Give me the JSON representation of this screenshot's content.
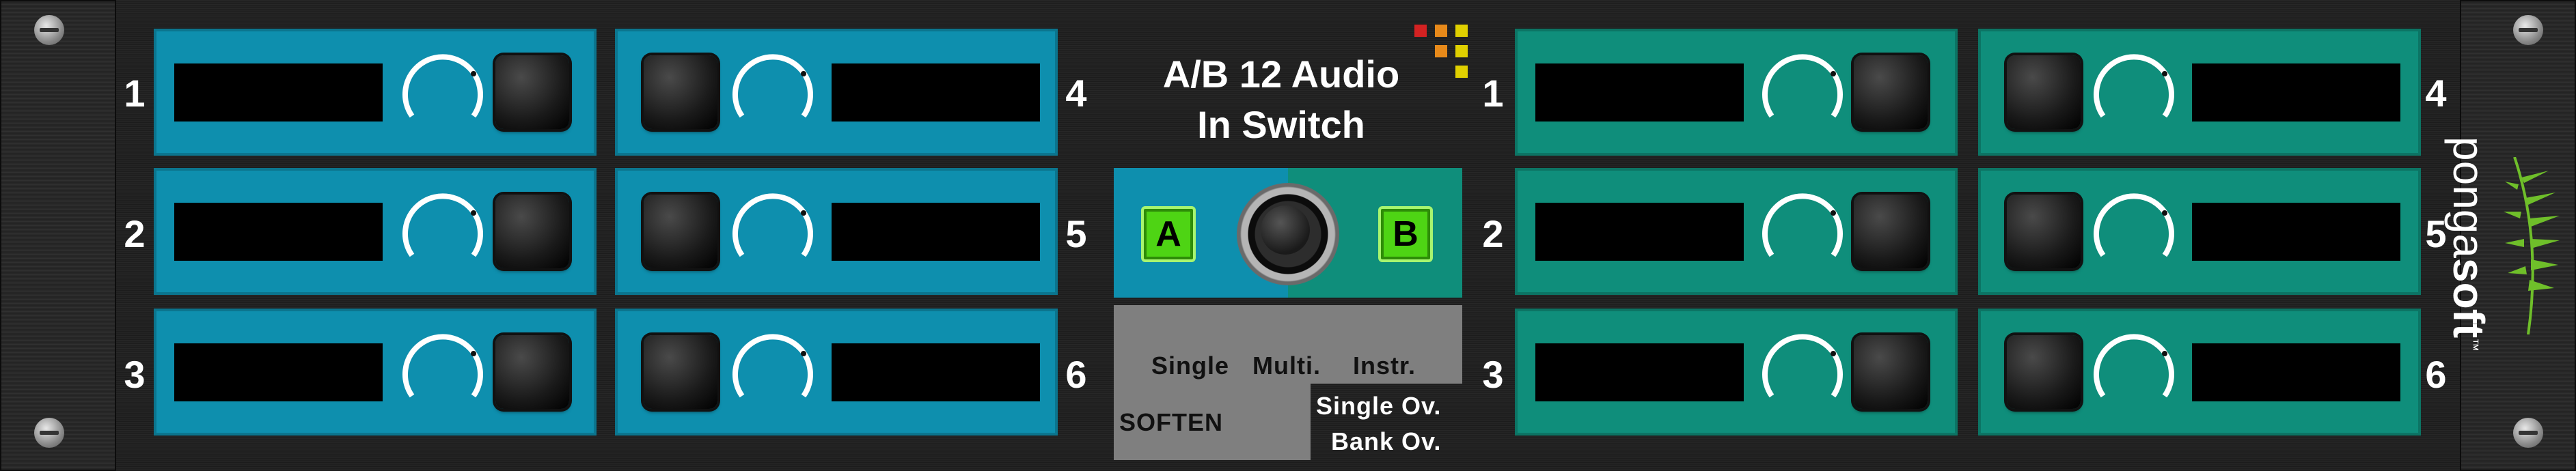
{
  "title": {
    "line1": "A/B 12 Audio",
    "line2": "In Switch"
  },
  "brand": {
    "left": "ponga",
    "right": "soft",
    "tm": "™"
  },
  "bank_a": {
    "numbers": [
      "1",
      "2",
      "3",
      "4",
      "5",
      "6"
    ]
  },
  "bank_b": {
    "numbers": [
      "1",
      "2",
      "3",
      "4",
      "5",
      "6"
    ]
  },
  "ab_switch": {
    "a_label": "A",
    "b_label": "B"
  },
  "modes": {
    "single": "Single",
    "multi": "Multi.",
    "instr": "Instr.",
    "soften": "SOFTEN",
    "single_ov": "Single Ov.",
    "bank_ov": "Bank Ov."
  },
  "colors": {
    "bank_a": "#0e8fae",
    "bank_b": "#0f8e7b",
    "ab_button": "#4ed414",
    "mode_panel": "#7f7f7f"
  }
}
